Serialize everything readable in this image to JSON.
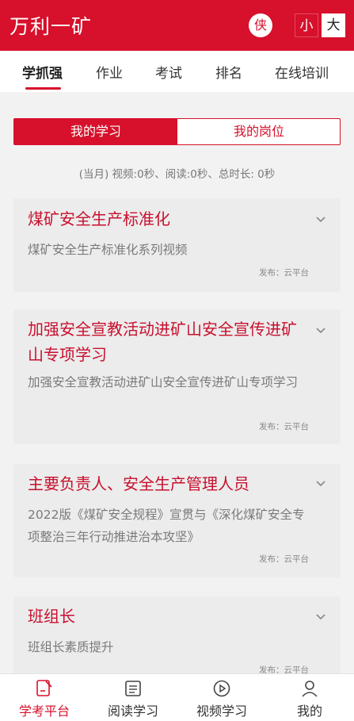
{
  "header": {
    "title": "万利一矿",
    "avatar_text": "侠",
    "size_small": "小",
    "size_large": "大"
  },
  "tabs": [
    {
      "label": "学抓强",
      "active": true
    },
    {
      "label": "作业"
    },
    {
      "label": "考试"
    },
    {
      "label": "排名"
    },
    {
      "label": "在线培训"
    }
  ],
  "segments": {
    "my_study": "我的学习",
    "my_post": "我的岗位"
  },
  "stats": "(当月) 视频:0秒、阅读:0秒、总时长: 0秒",
  "cards": [
    {
      "title": "煤矿安全生产标准化",
      "desc": "煤矿安全生产标准化系列视频",
      "pub": "发布：云平台"
    },
    {
      "title": "加强安全宣教活动进矿山安全宣传进矿山专项学习",
      "desc": "加强安全宣教活动进矿山安全宣传进矿山专项学习",
      "pub": "发布：云平台"
    },
    {
      "title": "主要负责人、安全生产管理人员",
      "desc": "2022版《煤矿安全规程》宣贯与《深化煤矿安全专项整治三年行动推进治本攻坚》",
      "pub": "发布：云平台"
    },
    {
      "title": "班组长",
      "desc": "班组长素质提升",
      "pub": "发布：云平台"
    }
  ],
  "bottom_nav": [
    {
      "label": "学考平台",
      "icon": "edit-doc-icon",
      "active": true
    },
    {
      "label": "阅读学习",
      "icon": "list-doc-icon"
    },
    {
      "label": "视频学习",
      "icon": "play-circle-icon"
    },
    {
      "label": "我的",
      "icon": "user-icon"
    }
  ],
  "colors": {
    "brand": "#d7102b",
    "card_title": "#c8102e",
    "background": "#f2f2f2"
  }
}
